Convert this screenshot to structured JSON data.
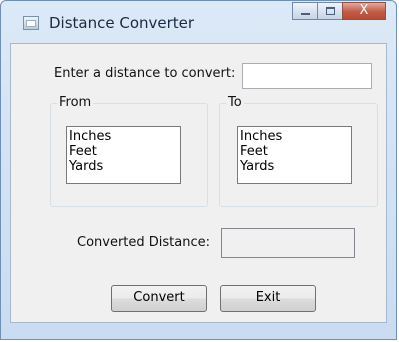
{
  "window": {
    "title": "Distance Converter",
    "close_glyph": "X"
  },
  "form": {
    "prompt_label": "Enter a distance to convert:",
    "distance_value": "",
    "from_group": {
      "label": "From",
      "options": [
        "Inches",
        "Feet",
        "Yards"
      ]
    },
    "to_group": {
      "label": "To",
      "options": [
        "Inches",
        "Feet",
        "Yards"
      ]
    },
    "converted_label": "Converted Distance:",
    "converted_value": "",
    "convert_button": "Convert",
    "exit_button": "Exit"
  },
  "icons": {
    "app": "form-window-icon",
    "minimize": "minimize-icon",
    "maximize": "maximize-icon",
    "close": "close-icon"
  }
}
